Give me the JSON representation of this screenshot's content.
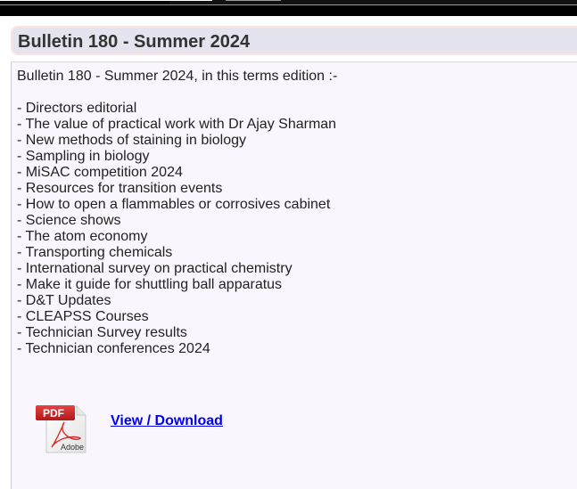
{
  "bulletin": {
    "title": "Bulletin 180 - Summer 2024",
    "intro": "Bulletin 180 - Summer 2024, in this terms edition :-",
    "items": [
      "- Directors editorial",
      "- The value of practical work with Dr Ajay Sharman",
      "- New methods of staining in biology",
      "- Sampling in biology",
      "- MiSAC competition 2024",
      "- Resources for transition events",
      "- How to open a flammables or corrosives cabinet",
      "- Science shows",
      "- The atom economy",
      "- Transporting chemicals",
      "- International survey on practical chemistry",
      "- Make it guide for shuttling ball apparatus",
      "- D&T Updates",
      "- CLEAPSS Courses",
      "- Technician Survey results",
      "- Technician conferences 2024"
    ],
    "download": {
      "icon": "pdf-adobe-icon",
      "icon_badge": "PDF",
      "icon_caption": "Adobe",
      "link_label": "View / Download"
    }
  },
  "colors": {
    "title_bg": "#e4e4ee",
    "title_border": "#fbe3e3",
    "content_bg": "#f9f7fd",
    "link": "#0000ee",
    "pdf_red": "#d52b2b"
  }
}
